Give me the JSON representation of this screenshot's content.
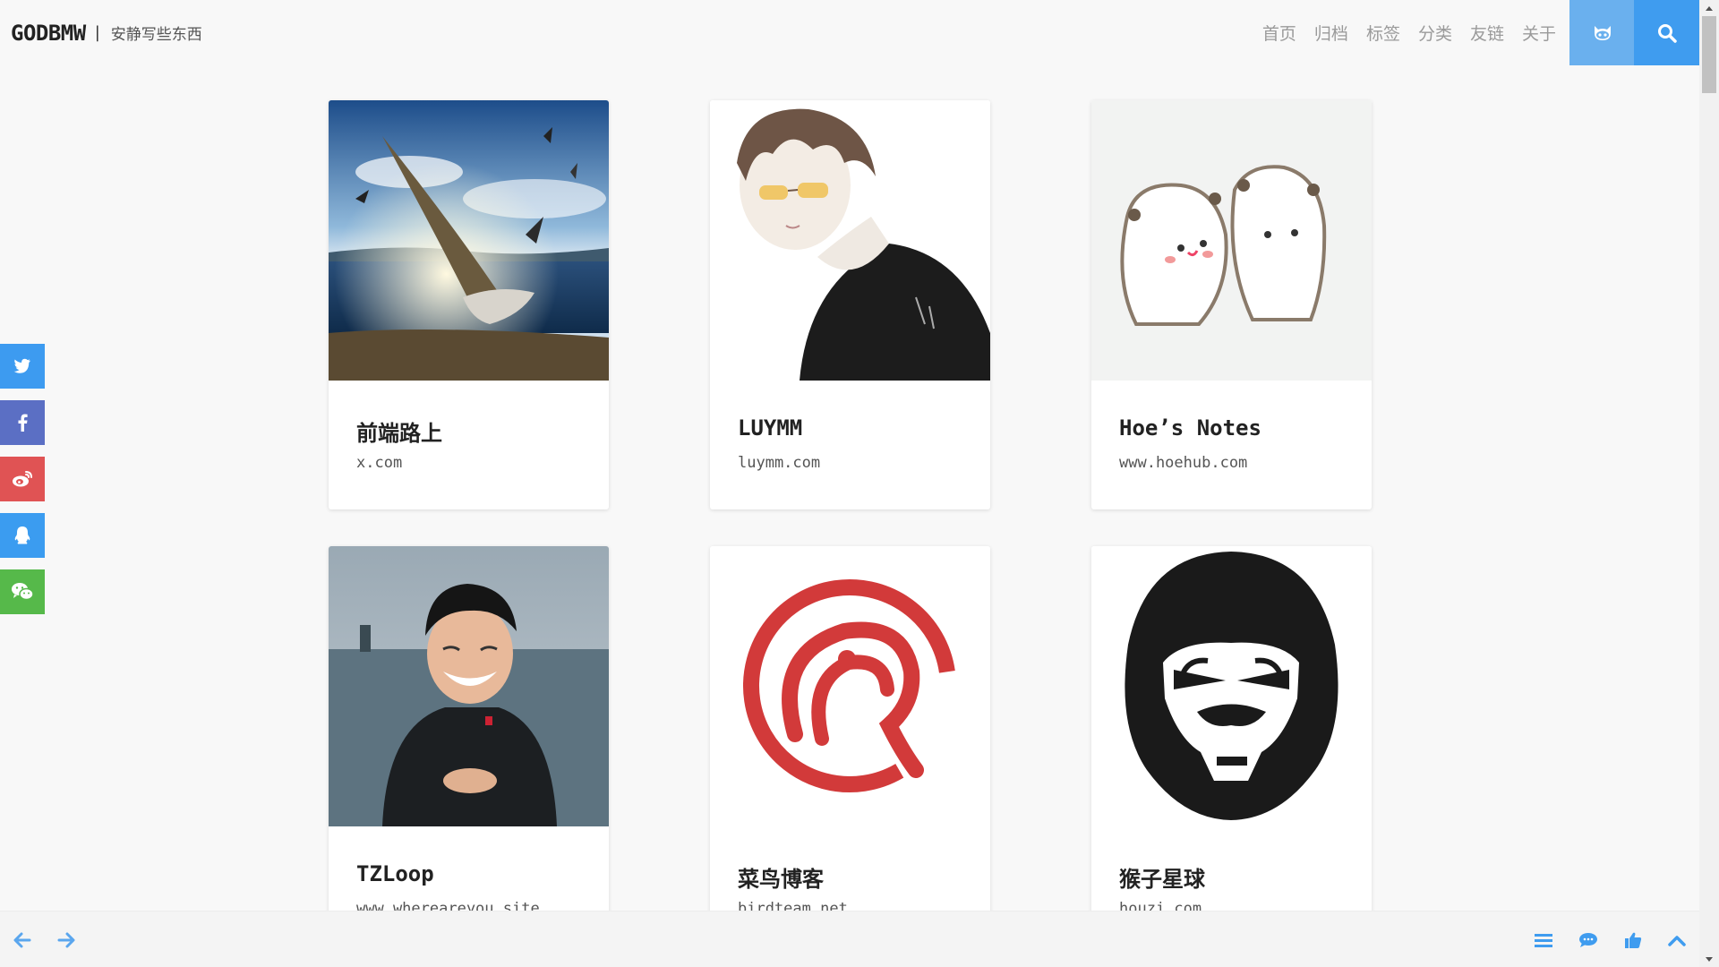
{
  "header": {
    "brand": "GODBMW",
    "separator": "|",
    "tagline": "安静写些东西",
    "nav": [
      "首页",
      "归档",
      "标签",
      "分类",
      "友链",
      "关于"
    ],
    "github_icon": "github-cat-icon",
    "search_icon": "search-icon"
  },
  "share": [
    {
      "icon": "twitter-icon",
      "color": "#3d9bf0"
    },
    {
      "icon": "facebook-icon",
      "color": "#5b6fc4"
    },
    {
      "icon": "weibo-icon",
      "color": "#e05354"
    },
    {
      "icon": "qq-icon",
      "color": "#3b9cf0"
    },
    {
      "icon": "wechat-icon",
      "color": "#56b94a"
    }
  ],
  "friends": [
    {
      "title": "前端路上",
      "url": "x.com",
      "image": "seagull-photo"
    },
    {
      "title": "LUYMM",
      "url": "luymm.com",
      "image": "anime-boy-avatar"
    },
    {
      "title": "Hoe’s Notes",
      "url": "www.hoehub.com",
      "image": "bears-cartoon"
    },
    {
      "title": "TZLoop",
      "url": "www.whereareyou.site",
      "image": "laughing-man-photo"
    },
    {
      "title": "菜鸟博客",
      "url": "birdteam.net",
      "image": "bird-logo"
    },
    {
      "title": "猴子星球",
      "url": "houzi.com",
      "image": "gorilla-logo"
    }
  ],
  "bottom_bar": {
    "left": [
      "back-arrow-icon",
      "forward-arrow-icon"
    ],
    "right": [
      "menu-icon",
      "comment-icon",
      "like-icon",
      "to-top-icon"
    ]
  },
  "colors": {
    "accent": "#3f9cef",
    "accent_light": "#6ab0ee",
    "nav_text": "#9a9a9a"
  }
}
